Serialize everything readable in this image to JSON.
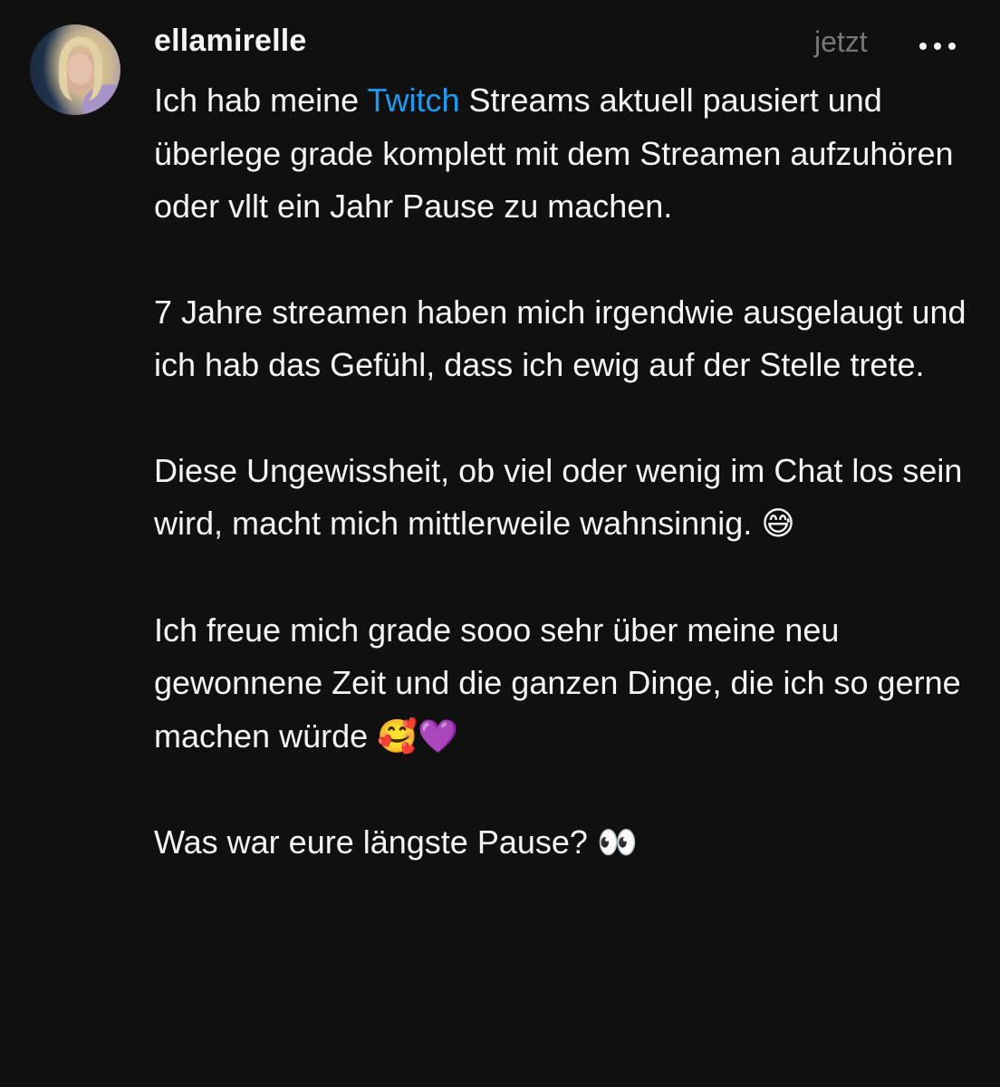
{
  "post": {
    "username": "ellamirelle",
    "timestamp": "jetzt",
    "more_icon": "more-horizontal-icon",
    "accent_color": "#1d9bf0",
    "paragraph1": {
      "before": "Ich hab meine ",
      "link": "Twitch",
      "after": " Streams aktuell pausiert und überlege grade komplett mit dem Streamen aufzuhören oder vllt ein Jahr Pause zu machen."
    },
    "paragraph2": "7 Jahre streamen haben mich irgendwie ausgelaugt und ich hab das Gefühl, dass ich ewig auf der Stelle trete.",
    "paragraph3": {
      "text": "Diese Ungewissheit, ob viel oder wenig im Chat los sein wird, macht mich mittlerweile wahnsinnig.",
      "emoji": "😅"
    },
    "paragraph4": {
      "text": "Ich freue mich grade sooo sehr über meine neu gewonnene Zeit und die ganzen Dinge, die ich so gerne machen würde",
      "emoji": "🥰💜"
    },
    "paragraph5": {
      "text": "Was war eure längste Pause?",
      "emoji": "👀"
    }
  }
}
